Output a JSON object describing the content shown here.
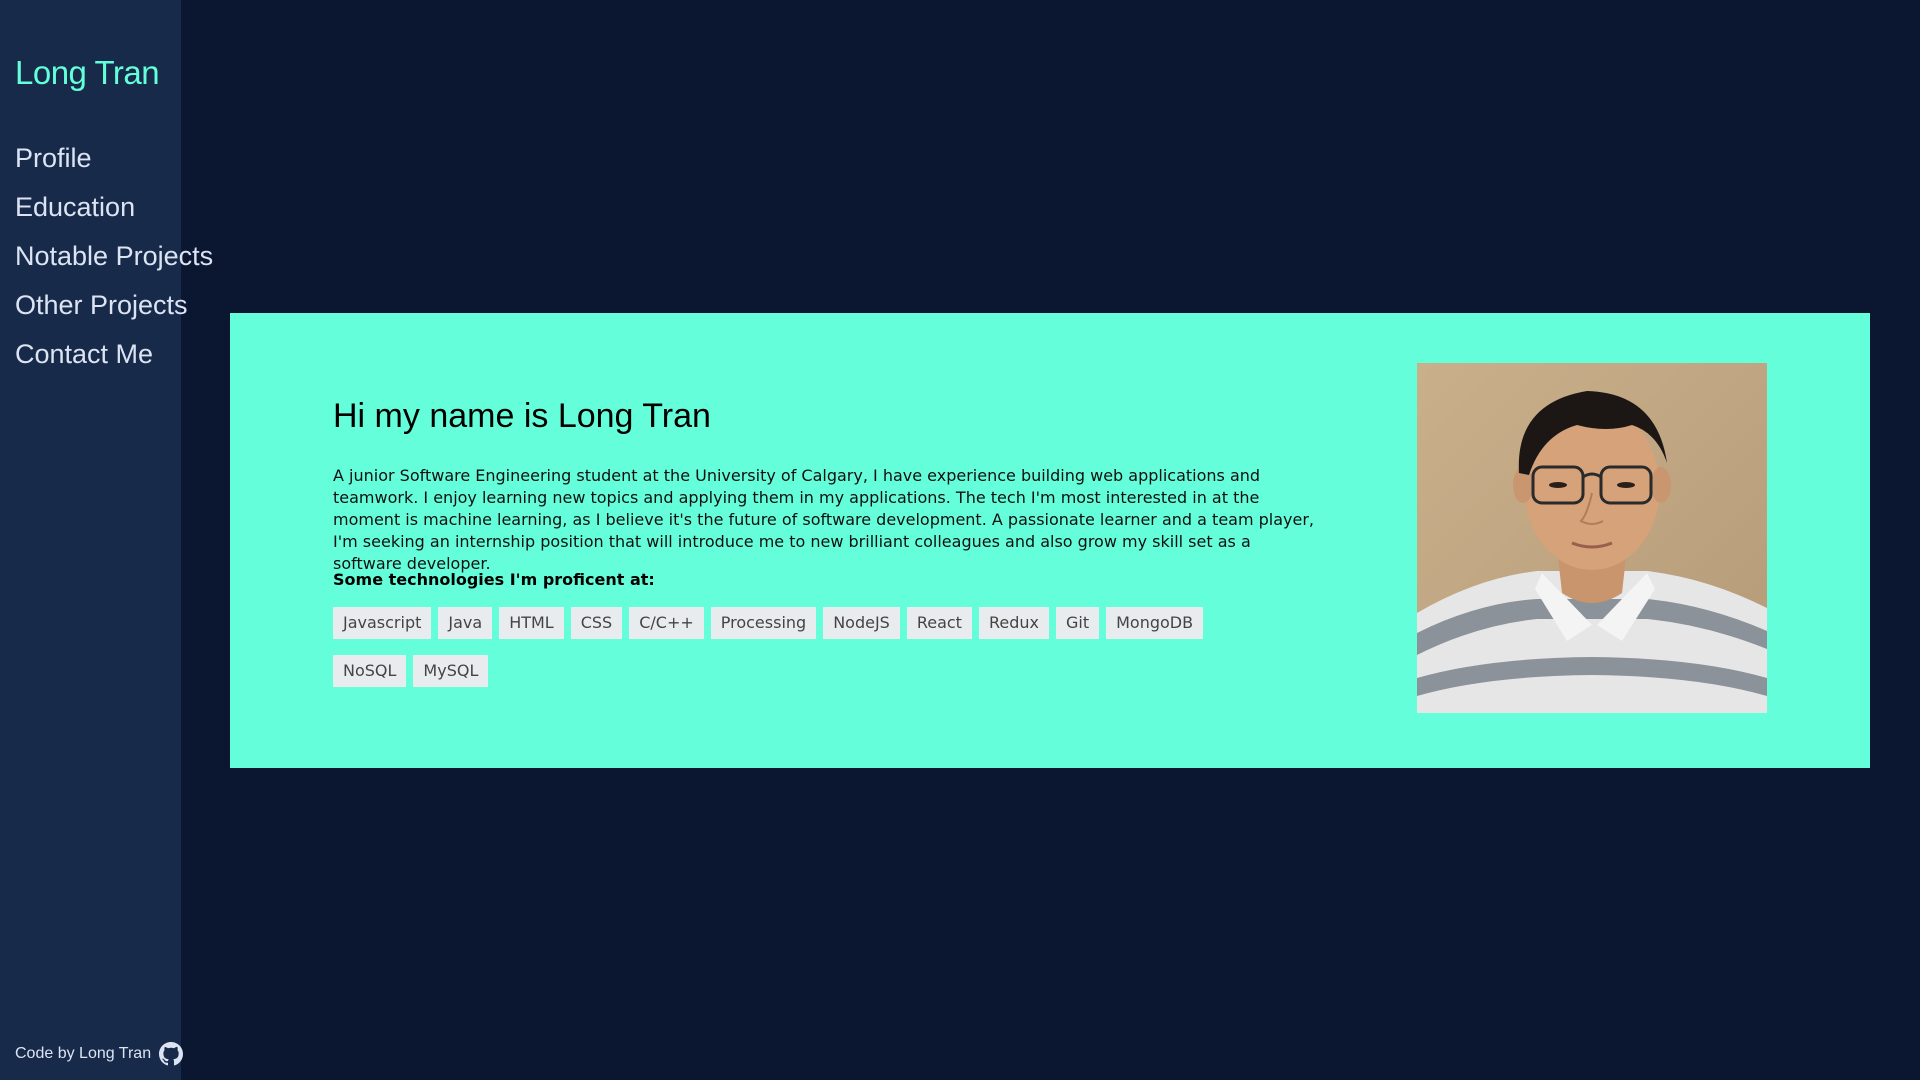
{
  "sidebar": {
    "brand": "Long Tran",
    "items": [
      {
        "label": "Profile"
      },
      {
        "label": "Education"
      },
      {
        "label": "Notable Projects"
      },
      {
        "label": "Other Projects"
      },
      {
        "label": "Contact Me"
      }
    ],
    "credit": "Code by Long Tran",
    "credit_icon": "github-icon"
  },
  "profile": {
    "heading": "Hi my name is Long Tran",
    "bio": "A junior Software Engineering student at the University of Calgary, I have experience building web applications and teamwork. I enjoy learning new topics and applying them in my applications. The tech I'm most interested in at the moment is machine learning, as I believe it's the future of software development. A passionate learner and a team player, I'm seeking an internship position that will introduce me to new brilliant colleagues and also grow my skill set as a software developer.",
    "technologies_title": "Some technologies I'm proficent at:",
    "technologies": [
      "Javascript",
      "Java",
      "HTML",
      "CSS",
      "C/C++",
      "Processing",
      "NodeJS",
      "React",
      "Redux",
      "Git",
      "MongoDB",
      "NoSQL",
      "MySQL"
    ]
  },
  "colors": {
    "page_background": "#0b1730",
    "sidebar_background": "#172a4a",
    "accent": "#64ffda",
    "nav_text": "#dce3f2",
    "tag_background": "#e9ecef"
  }
}
